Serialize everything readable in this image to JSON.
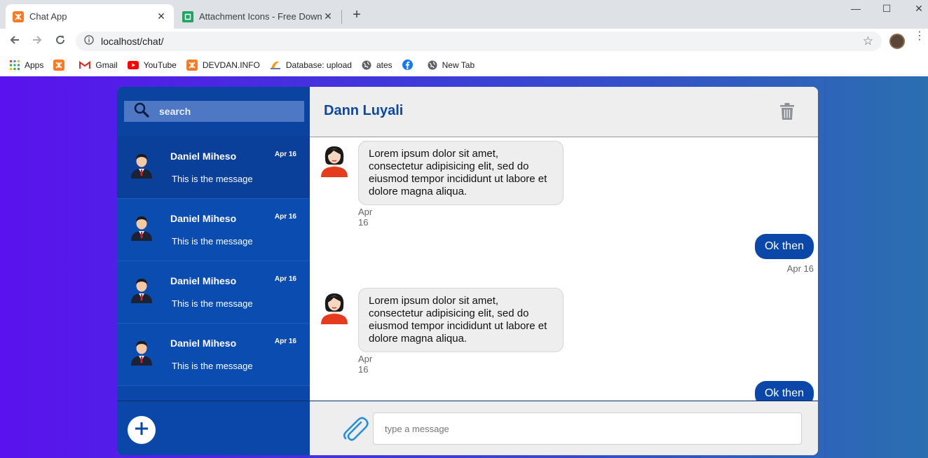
{
  "browser": {
    "tabs": [
      {
        "title": "Chat App",
        "active": true,
        "icon": "xampp-icon"
      },
      {
        "title": "Attachment Icons - Free Download",
        "active": false,
        "icon": "attachment-site-icon"
      }
    ],
    "url": "localhost/chat/",
    "bookmarks": [
      {
        "label": "Apps",
        "icon": "apps-grid-icon"
      },
      {
        "label": "",
        "icon": "xampp-icon"
      },
      {
        "label": "Gmail",
        "icon": "gmail-icon"
      },
      {
        "label": "YouTube",
        "icon": "youtube-icon"
      },
      {
        "label": "DEVDAN.INFO",
        "icon": "xampp-icon"
      },
      {
        "label": "Database: upload",
        "icon": "phpmyadmin-icon"
      },
      {
        "label": "ates",
        "icon": "globe-icon"
      },
      {
        "label": "",
        "icon": "facebook-icon"
      },
      {
        "label": "New Tab",
        "icon": "globe-icon"
      }
    ]
  },
  "sidebar": {
    "search_placeholder": "search",
    "contacts": [
      {
        "name": "Daniel Miheso",
        "date": "Apr 16",
        "message": "This is the message",
        "active": true
      },
      {
        "name": "Daniel Miheso",
        "date": "Apr 16",
        "message": "This is the message",
        "active": false
      },
      {
        "name": "Daniel Miheso",
        "date": "Apr 16",
        "message": "This is the message",
        "active": false
      },
      {
        "name": "Daniel Miheso",
        "date": "Apr 16",
        "message": "This is the message",
        "active": false
      }
    ]
  },
  "chat": {
    "title": "Dann Luyali",
    "messages": [
      {
        "direction": "in",
        "text": "Lorem ipsum dolor sit amet, consectetur adipisicing elit, sed do eiusmod tempor incididunt ut labore et dolore magna aliqua.",
        "date": "Apr 16"
      },
      {
        "direction": "out",
        "text": "Ok then",
        "date": "Apr 16"
      },
      {
        "direction": "in",
        "text": "Lorem ipsum dolor sit amet, consectetur adipisicing elit, sed do eiusmod tempor incididunt ut labore et dolore magna aliqua.",
        "date": "Apr 16"
      },
      {
        "direction": "out",
        "text": "Ok then",
        "date": ""
      }
    ],
    "input_placeholder": "type a message"
  },
  "colors": {
    "accent": "#0a47a8",
    "sidebar_bg": "#0b4cb0",
    "bubble_in": "#eeeeef",
    "bubble_out": "#0a47a8"
  }
}
